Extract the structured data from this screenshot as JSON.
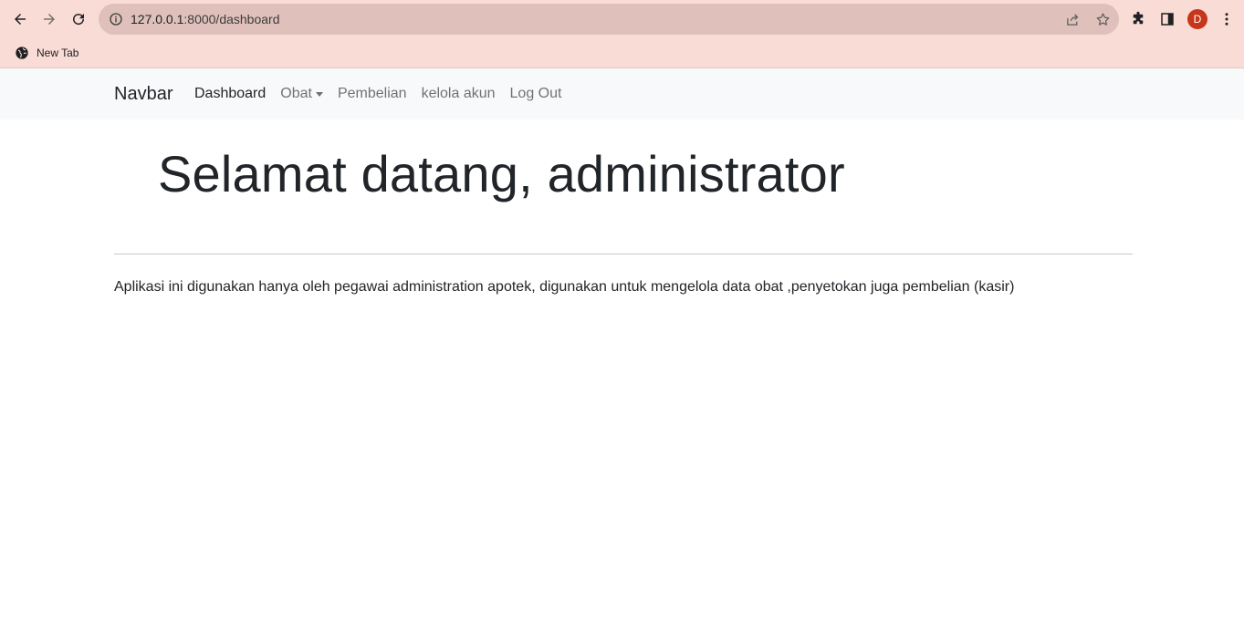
{
  "browser": {
    "url_host": "127.0.0.1",
    "url_path": ":8000/dashboard",
    "profile_initial": "D",
    "bookmarks": [
      {
        "label": "New Tab",
        "icon": "globe-icon"
      }
    ],
    "colors": {
      "frame": "#fadcd6",
      "omnibox": "#dfc0bb",
      "avatar": "#c5361b"
    }
  },
  "navbar": {
    "brand": "Navbar",
    "links": [
      {
        "label": "Dashboard",
        "active": true
      },
      {
        "label": "Obat",
        "dropdown": true
      },
      {
        "label": "Pembelian"
      },
      {
        "label": "kelola akun"
      },
      {
        "label": "Log Out"
      }
    ]
  },
  "main": {
    "title": "Selamat datang, administrator",
    "description": "Aplikasi ini digunakan hanya oleh pegawai administration apotek, digunakan untuk mengelola data obat ,penyetokan juga pembelian (kasir)"
  }
}
